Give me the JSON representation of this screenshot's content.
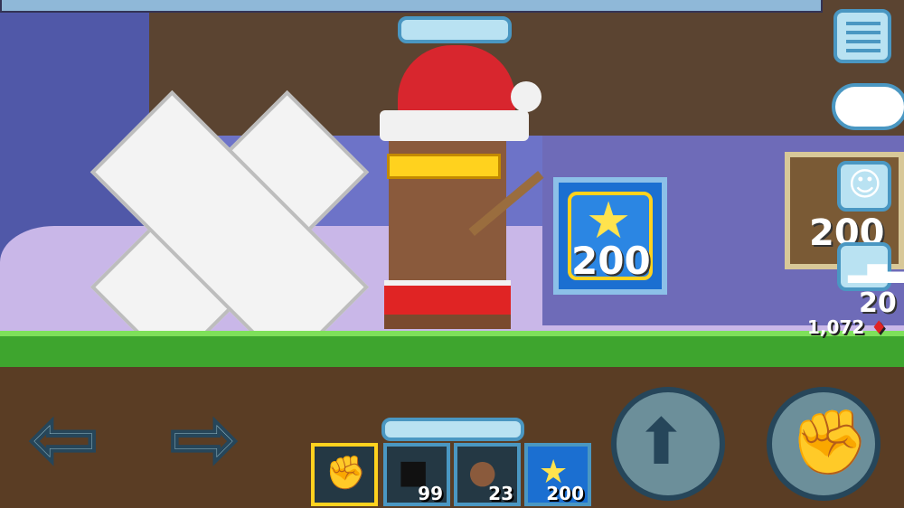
{
  "world": {
    "gem_block": {
      "icon": "star-icon",
      "count": "200"
    },
    "right_block": {
      "count_top": "200",
      "count_bottom": "20"
    }
  },
  "hud": {
    "menu": {
      "icon": "menu-icon"
    },
    "chat": {
      "icon": "chat-bubble-icon"
    },
    "emote": {
      "icon": "smiley-icon"
    },
    "leaderboard": {
      "icon": "podium-icon"
    },
    "gems": {
      "value": "1,072",
      "icon": "gem-icon"
    }
  },
  "controls": {
    "left": {
      "icon": "arrow-left-icon"
    },
    "right": {
      "icon": "arrow-right-icon"
    },
    "jump": {
      "icon": "arrow-up-icon"
    },
    "punch": {
      "icon": "fist-icon"
    }
  },
  "inventory": {
    "slots": [
      {
        "name": "fist",
        "icon": "fist-icon",
        "count": ""
      },
      {
        "name": "block",
        "icon": "block-icon",
        "count": "99"
      },
      {
        "name": "seed",
        "icon": "seed-icon",
        "count": "23"
      },
      {
        "name": "gem-block",
        "icon": "star-icon",
        "count": "200"
      }
    ]
  }
}
